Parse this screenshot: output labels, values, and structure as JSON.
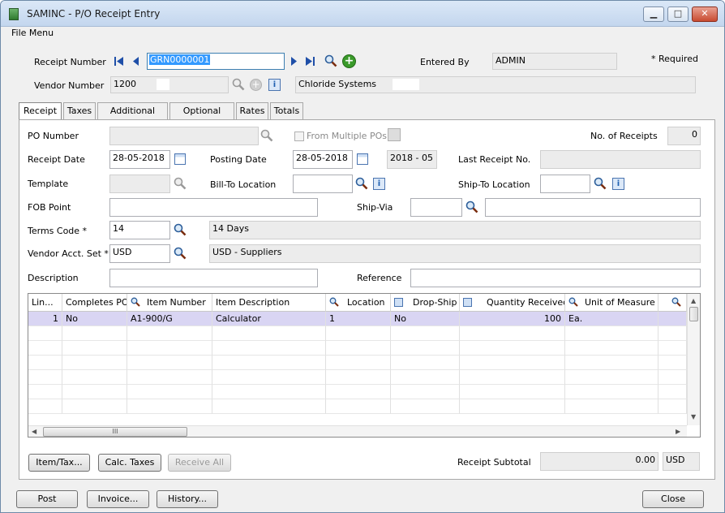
{
  "window": {
    "title": "SAMINC - P/O Receipt Entry",
    "menu": "File Menu"
  },
  "header": {
    "receipt_number_label": "Receipt Number",
    "receipt_number": "GRN0000001",
    "entered_by_label": "Entered By",
    "entered_by": "ADMIN",
    "required_note": "*  Required",
    "vendor_number_label": "Vendor Number",
    "vendor_number": "1200",
    "vendor_name": "Chloride Systems"
  },
  "tabs": [
    {
      "label": "Receipt"
    },
    {
      "label": "Taxes"
    },
    {
      "label": "Additional Costs"
    },
    {
      "label": "Optional Fields"
    },
    {
      "label": "Rates"
    },
    {
      "label": "Totals"
    }
  ],
  "receipt": {
    "po_number_label": "PO Number",
    "po_number": "",
    "from_multiple_pos_label": "From Multiple POs",
    "no_of_receipts_label": "No. of Receipts",
    "no_of_receipts": "0",
    "receipt_date_label": "Receipt Date",
    "receipt_date": "28-05-2018",
    "posting_date_label": "Posting Date",
    "posting_date": "28-05-2018",
    "fiscal_period": "2018 - 05",
    "last_receipt_no_label": "Last Receipt No.",
    "last_receipt_no": "",
    "template_label": "Template",
    "bill_to_label": "Bill-To Location",
    "ship_to_label": "Ship-To Location",
    "fob_label": "FOB Point",
    "ship_via_label": "Ship-Via",
    "terms_code_label": "Terms Code *",
    "terms_code": "14",
    "terms_desc": "14 Days",
    "vendor_acct_set_label": "Vendor Acct. Set *",
    "vendor_acct_set": "USD",
    "vendor_acct_set_desc": "USD - Suppliers",
    "description_label": "Description",
    "reference_label": "Reference"
  },
  "grid": {
    "columns": [
      "Lin...",
      "Completes PO",
      "Item Number",
      "Item Description",
      "Location",
      "Drop-Ship",
      "Quantity Received",
      "Unit of Measure"
    ],
    "rows": [
      {
        "line": "1",
        "completes_po": "No",
        "item_number": "A1-900/G",
        "item_description": "Calculator",
        "location": "1",
        "drop_ship": "No",
        "quantity_received": "100",
        "uom": "Ea."
      }
    ],
    "scroll_text": "III"
  },
  "buttons": {
    "item_tax": "Item/Tax...",
    "calc_taxes": "Calc. Taxes",
    "receive_all": "Receive All",
    "post": "Post",
    "invoice": "Invoice...",
    "history": "History...",
    "close": "Close"
  },
  "subtotal": {
    "label": "Receipt Subtotal",
    "value": "0.00",
    "currency": "USD"
  },
  "colors": {
    "selected_row": "#d9d5f3",
    "add_icon": "#3a9a2a",
    "nav_arrow": "#1f4fa8"
  }
}
